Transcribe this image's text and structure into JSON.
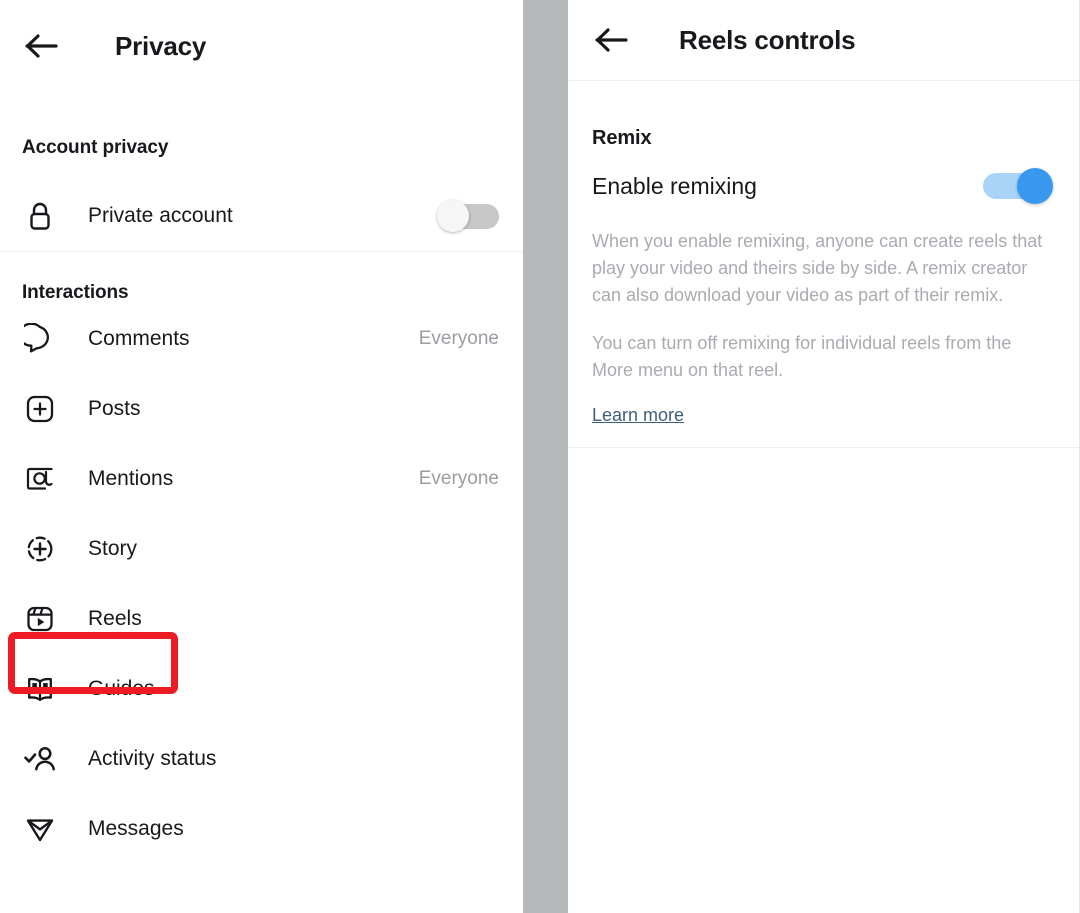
{
  "left_panel": {
    "back_icon": "back-arrow-icon",
    "title": "Privacy",
    "sections": [
      {
        "heading": "Account privacy",
        "items": [
          {
            "icon": "lock-icon",
            "label": "Private account",
            "control": "toggle-off",
            "value": ""
          }
        ]
      },
      {
        "heading": "Interactions",
        "items": [
          {
            "icon": "comment-bubble-icon",
            "label": "Comments",
            "value": "Everyone"
          },
          {
            "icon": "plus-square-icon",
            "label": "Posts",
            "value": ""
          },
          {
            "icon": "at-sign-icon",
            "label": "Mentions",
            "value": "Everyone"
          },
          {
            "icon": "story-circle-plus-icon",
            "label": "Story",
            "value": ""
          },
          {
            "icon": "reels-clapper-icon",
            "label": "Reels",
            "value": ""
          },
          {
            "icon": "guides-book-icon",
            "label": "Guides",
            "value": ""
          },
          {
            "icon": "activity-status-person-check-icon",
            "label": "Activity status",
            "value": ""
          },
          {
            "icon": "messages-paper-plane-icon",
            "label": "Messages",
            "value": ""
          }
        ]
      }
    ]
  },
  "right_panel": {
    "back_icon": "back-arrow-icon",
    "title": "Reels controls",
    "section_heading": "Remix",
    "toggle_label": "Enable remixing",
    "toggle_state": "on",
    "description_paragraph_1": "When you enable remixing, anyone can create reels that play your video and theirs side by side. A remix creator can also download your video as part of their remix.",
    "description_paragraph_2": "You can turn off remixing for individual reels from the More menu on that reel.",
    "learn_more_label": "Learn more"
  },
  "annotation": {
    "highlight_target": "Reels",
    "highlight_color": "#ed1c24"
  },
  "colors": {
    "accent_blue": "#3898f0",
    "toggle_track_on": "#a9d4f8",
    "toggle_track_off": "#c7c7c7",
    "text_primary": "#17191c",
    "text_muted": "#a8abb0",
    "link": "#3f5f7d",
    "gutter": "#b5b9ba"
  }
}
